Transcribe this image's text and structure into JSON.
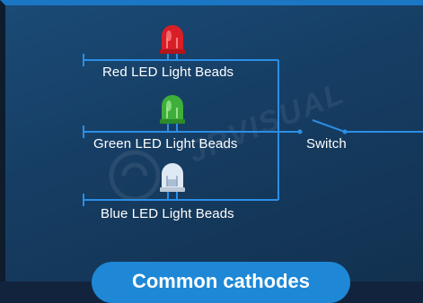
{
  "labels": {
    "red": "Red LED Light Beads",
    "green": "Green LED Light Beads",
    "blue": "Blue LED Light Beads",
    "switch": "Switch"
  },
  "footer": {
    "caption": "Common cathodes"
  },
  "watermark": {
    "text": "JRVISUAL"
  },
  "colors": {
    "background": "#163d63",
    "wire": "#2b8fe6",
    "red_led": "#d81f26",
    "green_led": "#3fae3a",
    "blue_led": "#dfe9f3",
    "pill": "#1e88d6"
  },
  "icons": [
    "red-led-icon",
    "green-led-icon",
    "blue-led-icon",
    "switch-icon",
    "logo-watermark-icon"
  ]
}
